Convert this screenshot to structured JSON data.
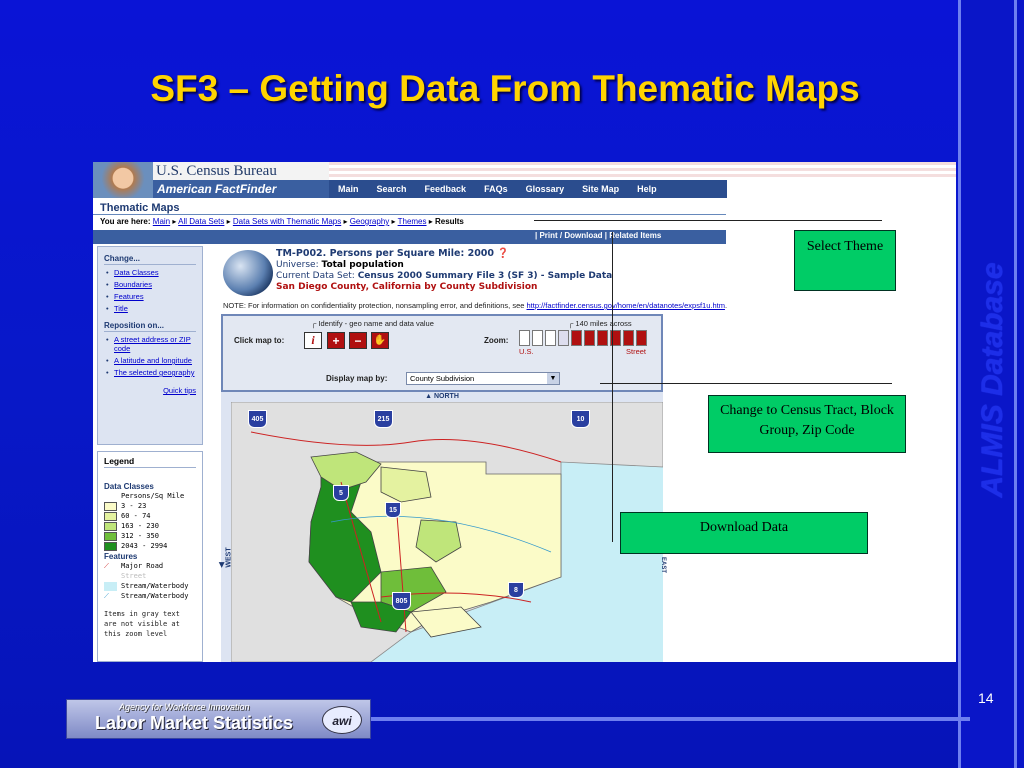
{
  "slide": {
    "title": "SF3 – Getting Data From Thematic Maps",
    "side_text": "ALMIS Database",
    "page_number": "14",
    "footer_tagline": "Agency for Workforce Innovation",
    "footer_name": "Labor Market Statistics",
    "footer_mark": "awi"
  },
  "browser": {
    "census_bureau": "U.S. Census Bureau",
    "factfinder": "American FactFinder",
    "nav": [
      "Main",
      "Search",
      "Feedback",
      "FAQs",
      "Glossary",
      "Site Map",
      "Help"
    ],
    "section_title": "Thematic Maps",
    "breadcrumb": {
      "prefix": "You are here:",
      "links": [
        "Main",
        "All Data Sets",
        "Data Sets with Thematic Maps",
        "Geography",
        "Themes"
      ],
      "current": "Results"
    },
    "strip_links": "|  Print / Download   |  Related Items"
  },
  "sidebar": {
    "change_head": "Change...",
    "change_items": [
      "Data Classes",
      "Boundaries",
      "Features",
      "Title"
    ],
    "reposition_head": "Reposition on...",
    "reposition_items": [
      "A street address or ZIP code",
      "A latitude and longitude",
      "The selected geography"
    ],
    "quick_tips": "Quick tips"
  },
  "legend": {
    "title": "Legend",
    "classes_head": "Data Classes",
    "unit": "Persons/Sq Mile",
    "classes": [
      {
        "label": "3 - 23",
        "color": "#fbfbc8"
      },
      {
        "label": "60 - 74",
        "color": "#e4f2a0"
      },
      {
        "label": "163 - 230",
        "color": "#bfe57a"
      },
      {
        "label": "312 - 350",
        "color": "#6fbe3a"
      },
      {
        "label": "2043 - 2994",
        "color": "#1f8f1f"
      }
    ],
    "features_head": "Features",
    "features": [
      "Major Road",
      "Street",
      "Stream/Waterbody",
      "Stream/Waterbody"
    ],
    "note": "Items in gray text are not visible at this zoom level"
  },
  "content": {
    "table_title": "TM-P002. Persons per Square Mile: 2000",
    "universe_label": "Universe:",
    "universe_value": "Total population",
    "dataset_label": "Current Data Set:",
    "dataset_value": "Census 2000 Summary File 3 (SF 3) - Sample Data",
    "geo": "San Diego County, California by County Subdivision",
    "note_prefix": "NOTE: For information on confidentiality protection, nonsampling error, and definitions, see",
    "note_link": "http://factfinder.census.gov/home/en/datanotes/expsf1u.htm",
    "note_suffix": "."
  },
  "controls": {
    "click_label": "Click map to:",
    "identify_label": "Identify - geo name and data value",
    "zoom_label": "Zoom:",
    "zoom_scale": "140 miles across",
    "zoom_left": "U.S.",
    "zoom_right": "Street",
    "display_label": "Display map by:",
    "display_value": "County Subdivision",
    "north": "NORTH",
    "west": "WEST",
    "east": "EAST"
  },
  "map": {
    "highways": [
      "405",
      "215",
      "10",
      "5",
      "15",
      "805",
      "8"
    ]
  },
  "callouts": {
    "select_theme": "Select Theme",
    "change_geo": "Change to Census Tract, Block Group, Zip Code",
    "download": "Download Data"
  }
}
